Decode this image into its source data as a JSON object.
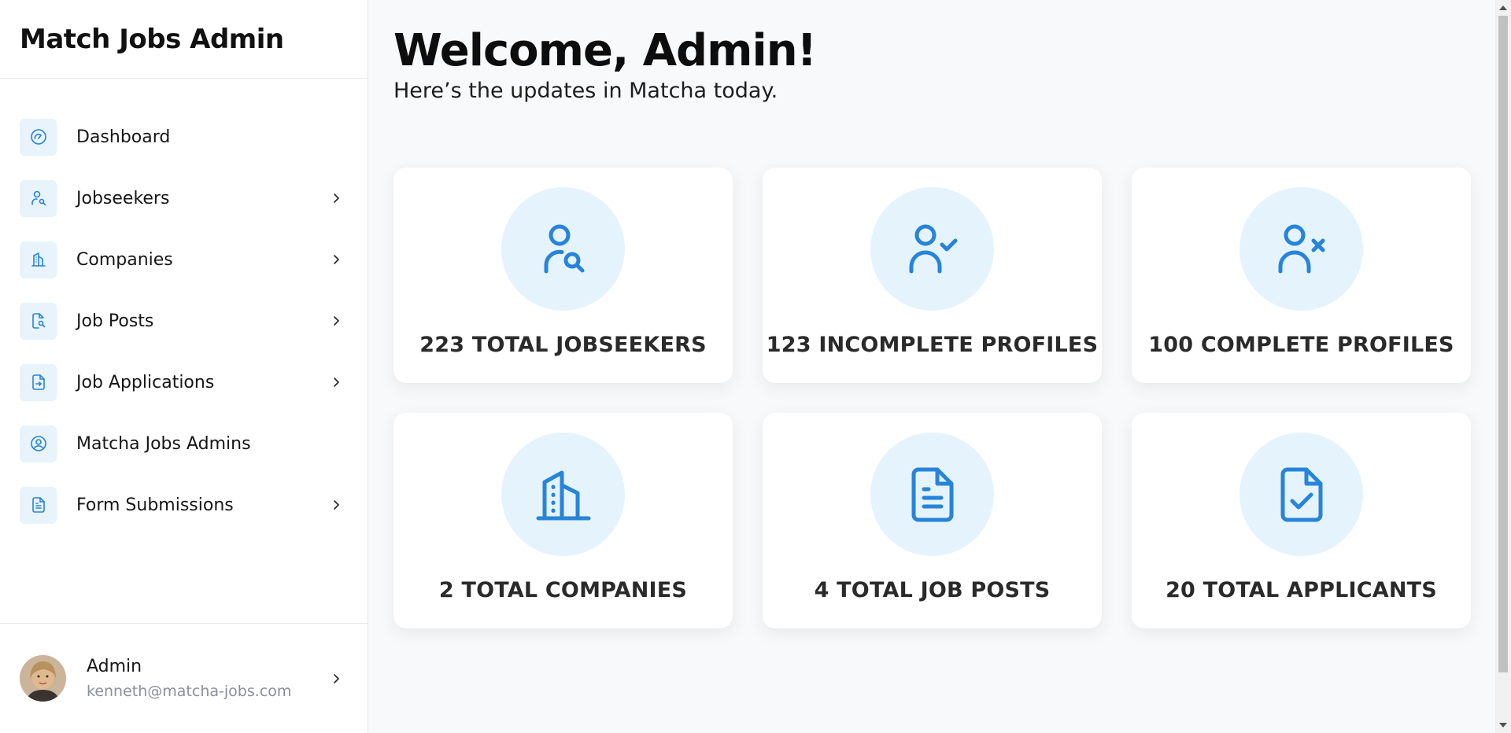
{
  "brand": {
    "title": "Match Jobs Admin"
  },
  "nav": [
    {
      "label": "Dashboard",
      "icon": "dashboard-gauge-icon",
      "has_chevron": false
    },
    {
      "label": "Jobseekers",
      "icon": "user-search-icon",
      "has_chevron": true
    },
    {
      "label": "Companies",
      "icon": "building-icon",
      "has_chevron": true
    },
    {
      "label": "Job Posts",
      "icon": "document-search-icon",
      "has_chevron": true
    },
    {
      "label": "Job Applications",
      "icon": "document-arrow-icon",
      "has_chevron": true
    },
    {
      "label": "Matcha Jobs Admins",
      "icon": "user-circle-icon",
      "has_chevron": false
    },
    {
      "label": "Form Submissions",
      "icon": "document-lines-icon",
      "has_chevron": true
    }
  ],
  "profile": {
    "name": "Admin",
    "email": "kenneth@matcha-jobs.com"
  },
  "main": {
    "welcome": "Welcome, Admin!",
    "subtitle": "Here’s the updates in Matcha today."
  },
  "stats": [
    {
      "label": "223 TOTAL JOBSEEKERS",
      "icon": "user-search-icon"
    },
    {
      "label": "123 INCOMPLETE PROFILES",
      "icon": "user-check-icon"
    },
    {
      "label": "100 COMPLETE PROFILES",
      "icon": "user-x-icon"
    },
    {
      "label": "2 TOTAL COMPANIES",
      "icon": "building-icon"
    },
    {
      "label": "4 TOTAL JOB POSTS",
      "icon": "document-icon"
    },
    {
      "label": "20 TOTAL APPLICANTS",
      "icon": "document-check-icon"
    }
  ],
  "colors": {
    "accent": "#2684d9",
    "icon_bg": "#e5f3fd",
    "page_bg": "#f8f9fb"
  }
}
